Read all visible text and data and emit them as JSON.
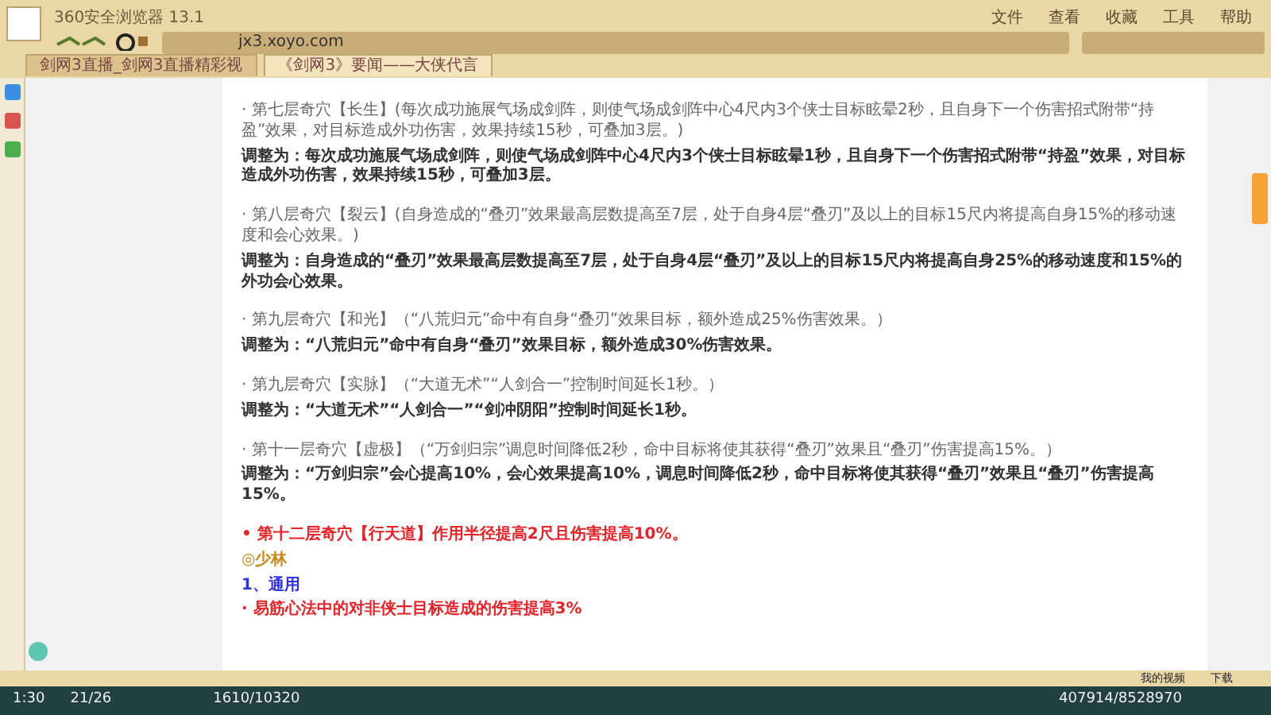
{
  "browser": {
    "title": "360安全浏览器 13.1",
    "address": "jx3.xoyo.com",
    "menu": [
      "文件",
      "查看",
      "收藏",
      "工具",
      "帮助"
    ],
    "tabs": [
      {
        "label": "剑网3直播_剑网3直播精彩视",
        "selected": false
      },
      {
        "label": "《剑网3》要闻——大侠代言",
        "selected": true
      }
    ],
    "status_items": [
      "我的视频",
      "下载"
    ]
  },
  "article": {
    "blocks": [
      {
        "kind": "original",
        "text": "· 第七层奇穴【长生】(每次成功施展气场成剑阵，则使气场成剑阵中心4尺内3个侠士目标眩晕2秒，且自身下一个伤害招式附带“持盈”效果，对目标造成外功伤害，效果持续15秒，可叠加3层。)"
      },
      {
        "kind": "adjust",
        "text": "调整为：每次成功施展气场成剑阵，**则使气场成剑阵中心4尺内3个侠士目标眩晕1秒**，且自身下一个伤害招式附带“持盈”效果，对目标造成外功伤害，效果持续15秒，可叠加3层。"
      },
      {
        "kind": "original",
        "text": "· 第八层奇穴【裂云】(自身造成的“叠刃”效果最高层数提高至7层，处于自身4层“叠刃”及以上的目标15尺内将提高自身15%的移动速度和会心效果。)"
      },
      {
        "kind": "adjust",
        "text": "调整为：自身造成的“叠刃”效果最高层数提高至7层，处于自身4层“叠刃”及以上的目标15尺内将**提高自身25%的移动速度**和15%的外功会心效果。"
      },
      {
        "kind": "original",
        "text": "· 第九层奇穴【和光】（“八荒归元”命中有自身“叠刃”效果目标，额外造成25%伤害效果。）"
      },
      {
        "kind": "adjust",
        "text": "调整为：“八荒归元”命中有自身“叠刃”效果目标，**额外造成30%伤害效果。**"
      },
      {
        "kind": "original",
        "text": "· 第九层奇穴【实脉】（“大道无术”“人剑合一”控制时间延长1秒。）"
      },
      {
        "kind": "adjust",
        "text": "调整为：“大道无术”“人剑合一”**“剑冲阴阳”**控制时间延长1秒。"
      },
      {
        "kind": "original",
        "text": "· 第十一层奇穴【虚极】（“万剑归宗”调息时间降低2秒，命中目标将使其获得“叠刃”效果且“叠刃”伤害提高15%。）"
      },
      {
        "kind": "adjust",
        "text": "调整为：**“万剑归宗”会心提高10%，会心效果提高10%**，调息时间降低2秒，命中目标将使其获得“叠刃”效果且“叠刃”伤害提高15%。"
      },
      {
        "kind": "note",
        "text": "• 第十二层奇穴【行天道】作用半径提高2尺且伤害提高10%。"
      },
      {
        "kind": "heading",
        "text": "◎少林"
      },
      {
        "kind": "subheading",
        "text": "1、通用"
      },
      {
        "kind": "note",
        "text": "· 易筋心法中的对非侠士目标造成的伤害提高3%"
      }
    ]
  },
  "game_hud": {
    "time": "1:30",
    "count": "21/26",
    "health": "1610/10320",
    "experience": "407914/8528970"
  }
}
